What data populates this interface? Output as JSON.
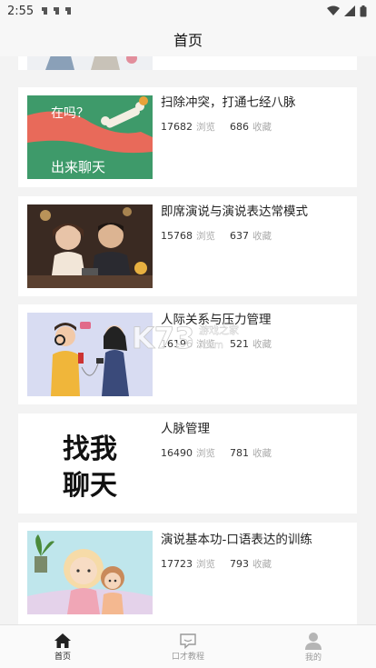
{
  "status_bar": {
    "time": "2:55"
  },
  "header": {
    "title": "首页"
  },
  "articles": [
    {
      "title": "扫除冲突，打通七经八脉",
      "views": "17682",
      "views_unit": "浏览",
      "favorites": "686",
      "favorites_unit": "收藏",
      "thumb_text_top": "在吗？",
      "thumb_text_bottom": "出来聊天"
    },
    {
      "title": "即席演说与演说表达常模式",
      "views": "15768",
      "views_unit": "浏览",
      "favorites": "637",
      "favorites_unit": "收藏"
    },
    {
      "title": "人际关系与压力管理",
      "views": "16196",
      "views_unit": "浏览",
      "favorites": "521",
      "favorites_unit": "收藏"
    },
    {
      "title": "人脉管理",
      "views": "16490",
      "views_unit": "浏览",
      "favorites": "781",
      "favorites_unit": "收藏",
      "thumb_text_top": "找我",
      "thumb_text_bottom": "聊天"
    },
    {
      "title": "演说基本功-口语表达的训练",
      "views": "17723",
      "views_unit": "浏览",
      "favorites": "793",
      "favorites_unit": "收藏"
    }
  ],
  "watermark": {
    "text": "K73",
    "sub": "游戏之家",
    "domain": ".com"
  },
  "tabbar": {
    "tabs": [
      {
        "label": "首页",
        "icon": "home-icon",
        "active": true
      },
      {
        "label": "口才教程",
        "icon": "chat-icon",
        "active": false
      },
      {
        "label": "我的",
        "icon": "person-icon",
        "active": false
      }
    ]
  },
  "colors": {
    "card_bg": "#ffffff",
    "page_bg": "#f3f3f3",
    "text": "#222222",
    "muted": "#aaaaaa"
  }
}
